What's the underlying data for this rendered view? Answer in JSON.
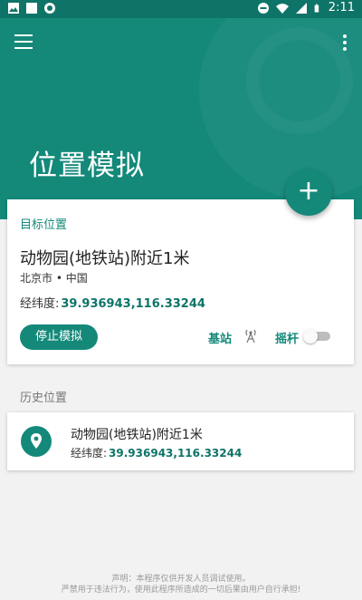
{
  "status_bar": {
    "time": "2:11",
    "left_icons": [
      "image-icon",
      "square-icon",
      "circle-icon"
    ],
    "right_icons": [
      "dnd-icon",
      "wifi-icon",
      "signal-icon",
      "battery-icon"
    ]
  },
  "colors": {
    "primary": "#14897a",
    "primary_dark": "#0e7467",
    "background": "#f2f2f2"
  },
  "header": {
    "title": "位置模拟",
    "menu_icon": "hamburger-menu-icon",
    "more_icon": "more-vert-icon"
  },
  "fab": {
    "label": "+"
  },
  "target": {
    "section_label": "目标位置",
    "name": "动物园(地铁站)附近1米",
    "region": "北京市 • 中国",
    "coord_label": "经纬度:",
    "coord_value": "39.936943,116.33244",
    "stop_button": "停止模拟",
    "base_station_label": "基站",
    "base_station_icon": "antenna-icon",
    "joystick_label": "摇杆",
    "joystick_enabled": false
  },
  "history": {
    "section_label": "历史位置",
    "items": [
      {
        "icon": "location-pin-icon",
        "name": "动物园(地铁站)附近1米",
        "coord_label": "经纬度:",
        "coord_value": "39.936943,116.33244"
      }
    ]
  },
  "disclaimer": {
    "line1": "声明：本程序仅供开发人员调试使用。",
    "line2": "严禁用于违法行为，使用此程序所造成的一切后果由用户自行承担!"
  }
}
